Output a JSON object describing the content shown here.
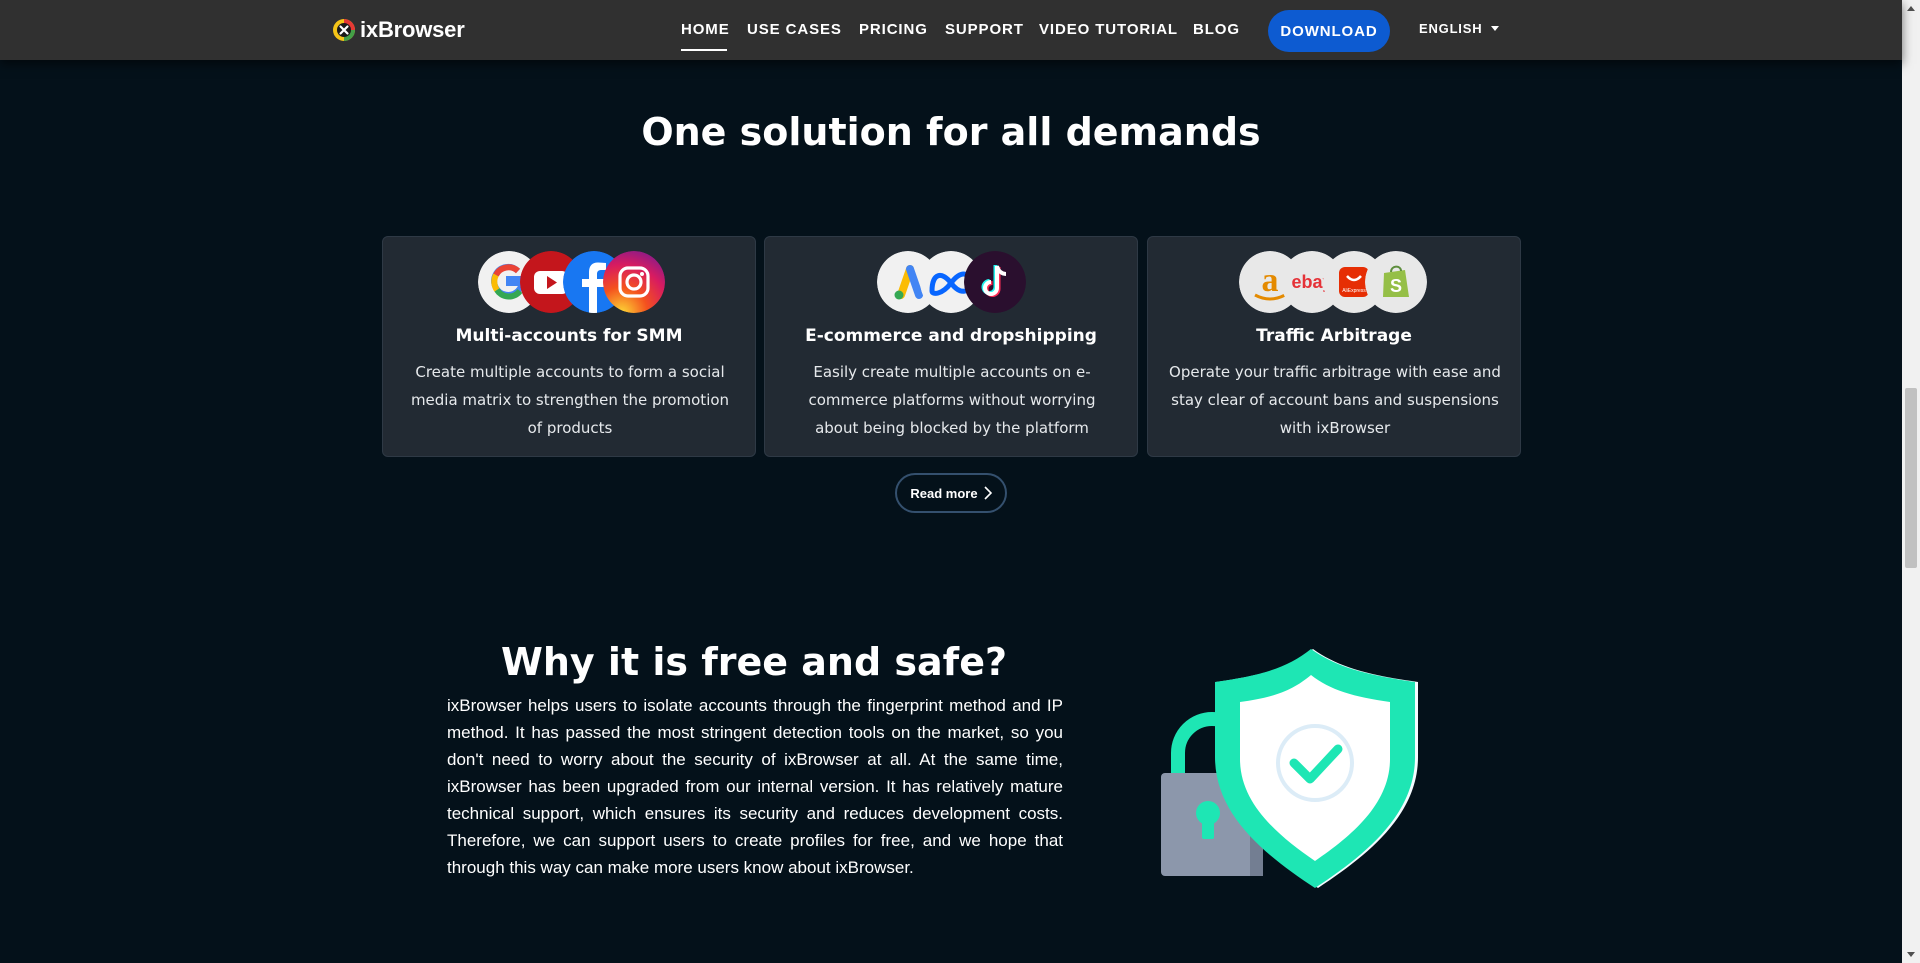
{
  "header": {
    "brand": "ixBrowser",
    "nav": [
      "HOME",
      "USE CASES",
      "PRICING",
      "SUPPORT",
      "VIDEO TUTORIAL",
      "BLOG"
    ],
    "active_nav": "HOME",
    "download_label": "DOWNLOAD",
    "language": "ENGLISH"
  },
  "solutions": {
    "title": "One solution for all demands",
    "cards": [
      {
        "title": "Multi-accounts for SMM",
        "description": "Create multiple accounts to form a social media matrix to strengthen the promotion of products",
        "icons": [
          "google-icon",
          "youtube-icon",
          "facebook-icon",
          "instagram-icon"
        ]
      },
      {
        "title": "E-commerce and dropshipping",
        "description": "Easily create multiple accounts on e-commerce platforms without worrying about being blocked by the platform",
        "icons": [
          "google-ads-icon",
          "meta-icon",
          "tiktok-icon"
        ]
      },
      {
        "title": "Traffic Arbitrage",
        "description": "Operate your traffic arbitrage with ease and stay clear of account bans and suspensions with ixBrowser",
        "icons": [
          "amazon-icon",
          "ebay-icon",
          "aliexpress-icon",
          "shopify-icon"
        ]
      }
    ],
    "read_more_label": "Read more"
  },
  "why": {
    "title": "Why it is free and safe?",
    "text": "ixBrowser helps users to isolate accounts through the fingerprint method and IP method. It has passed the most stringent detection tools on the market, so you don't need to worry about the security of ixBrowser at all. At the same time, ixBrowser has been upgraded from our internal version. It has relatively mature technical support, which ensures its security and reduces development costs. Therefore, we can support users to create profiles for free, and we hope that through this way can make more users know about ixBrowser.",
    "icon_text": {
      "ebay": "ebay",
      "aliexpress": "AliExpress"
    }
  },
  "colors": {
    "background": "#04111a",
    "nav_bg": "#303030",
    "card_bg": "#222a33",
    "accent_blue": "#0d5bd1",
    "shield_green": "#1ee6b4"
  }
}
